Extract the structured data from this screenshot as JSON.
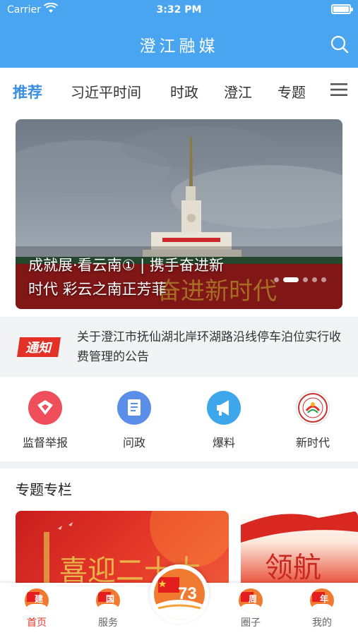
{
  "status": {
    "carrier": "Carrier",
    "time": "3:32 PM"
  },
  "header": {
    "title": "澄江融媒"
  },
  "tabs": [
    {
      "label": "推荐",
      "active": true
    },
    {
      "label": "习近平时间"
    },
    {
      "label": "时政"
    },
    {
      "label": "澄江"
    },
    {
      "label": "专题"
    }
  ],
  "banner": {
    "caption_line1": "成就展·看云南① | 携手奋进新",
    "caption_line2": "时代 彩云之南正芳菲",
    "slide_count": 5,
    "active_slide": 2,
    "image_text": "奋进新时代"
  },
  "notice": {
    "badge": "通知",
    "text": "关于澄江市抚仙湖北岸环湖路沿线停车泊位实行收费管理的公告"
  },
  "quick_links": [
    {
      "label": "监督举报",
      "icon": "heart-shield-icon",
      "color": "#ef4f5a"
    },
    {
      "label": "问政",
      "icon": "document-icon",
      "color": "#5a8ee8"
    },
    {
      "label": "爆料",
      "icon": "megaphone-icon",
      "color": "#3ea6ea"
    },
    {
      "label": "新时代",
      "icon": "emblem-logo"
    }
  ],
  "section": {
    "title": "专题专栏"
  },
  "cards": [
    {
      "text": "喜迎二十大"
    },
    {
      "text": "领航"
    }
  ],
  "tabbar": {
    "items": [
      {
        "label": "首页",
        "glyph": "建",
        "active": true
      },
      {
        "label": "服务",
        "glyph": "国"
      },
      {
        "label": "圈子",
        "glyph": "周"
      },
      {
        "label": "我的",
        "glyph": "年"
      }
    ],
    "center": {
      "number": "73"
    }
  },
  "colors": {
    "primary": "#4aa5f0",
    "active_tab": "#3a8fe3",
    "active_bottom": "#e4392a"
  }
}
